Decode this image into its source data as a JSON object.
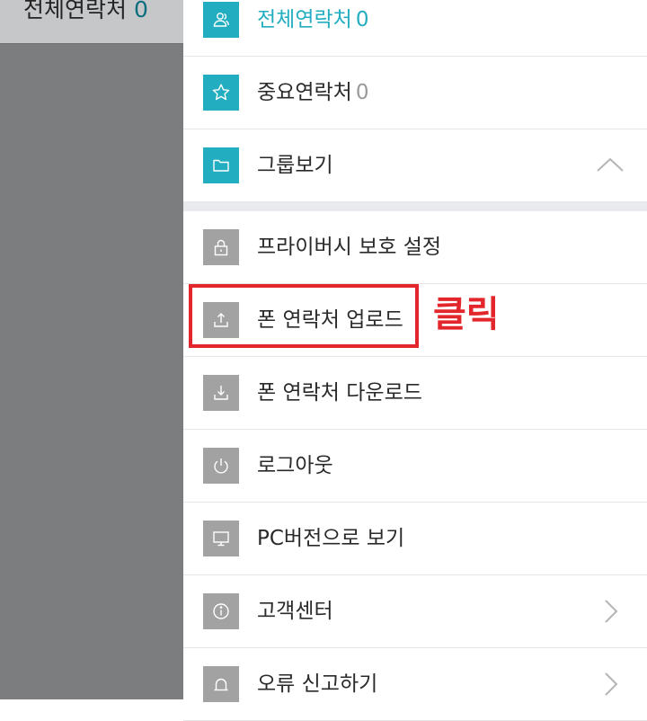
{
  "background": {
    "title": "전체연락처",
    "count": "0"
  },
  "menu": {
    "top": [
      {
        "id": "all-contacts",
        "label": "전체연락처",
        "count": "0",
        "icon": "people-icon",
        "accent": true
      },
      {
        "id": "important-contacts",
        "label": "중요연락처",
        "count": "0",
        "icon": "star-icon",
        "accent": false
      },
      {
        "id": "view-groups",
        "label": "그룹보기",
        "count": "",
        "icon": "folder-icon",
        "accent": false
      }
    ],
    "bottom": [
      {
        "id": "privacy-settings",
        "label": "프라이버시 보호 설정",
        "icon": "lock-icon"
      },
      {
        "id": "upload-phone-contacts",
        "label": "폰 연락처 업로드",
        "icon": "upload-icon"
      },
      {
        "id": "download-phone-contacts",
        "label": "폰 연락처 다운로드",
        "icon": "download-icon"
      },
      {
        "id": "logout",
        "label": "로그아웃",
        "icon": "power-icon"
      },
      {
        "id": "pc-version",
        "label": "PC버전으로 보기",
        "icon": "monitor-icon"
      },
      {
        "id": "customer-center",
        "label": "고객센터",
        "icon": "info-icon"
      },
      {
        "id": "report-error",
        "label": "오류 신고하기",
        "icon": "bell-icon"
      }
    ]
  },
  "annotation": {
    "text": "클릭"
  },
  "colors": {
    "accent": "#22aec0",
    "icon_gray": "#a2a2a2",
    "annotation_red": "#e3262b",
    "overlay": "#7c7d7f"
  }
}
